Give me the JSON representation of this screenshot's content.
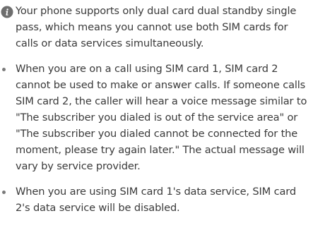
{
  "note": {
    "icon": "info-icon",
    "lines": [
      "Your phone supports only dual card dual standby single",
      "pass, which means you cannot use both SIM cards for",
      "calls or data services simultaneously."
    ]
  },
  "bullets": [
    {
      "lines": [
        "When you are on a call using SIM card 1, SIM card 2",
        "cannot be used to make or answer calls. If someone calls",
        "SIM card 2, the caller will hear a voice message similar to",
        "\"The subscriber you dialed is out of the service area\" or",
        "\"The subscriber you dialed cannot be connected for the",
        "moment, please try again later.\" The actual message will",
        "vary by service provider."
      ]
    },
    {
      "lines": [
        "When you are using SIM card 1's data service, SIM card",
        "2's data service will be disabled."
      ]
    }
  ],
  "colors": {
    "text": "#3a3a3a",
    "icon_bg": "#6e6e6e",
    "bullet": "#7a7a7a"
  }
}
